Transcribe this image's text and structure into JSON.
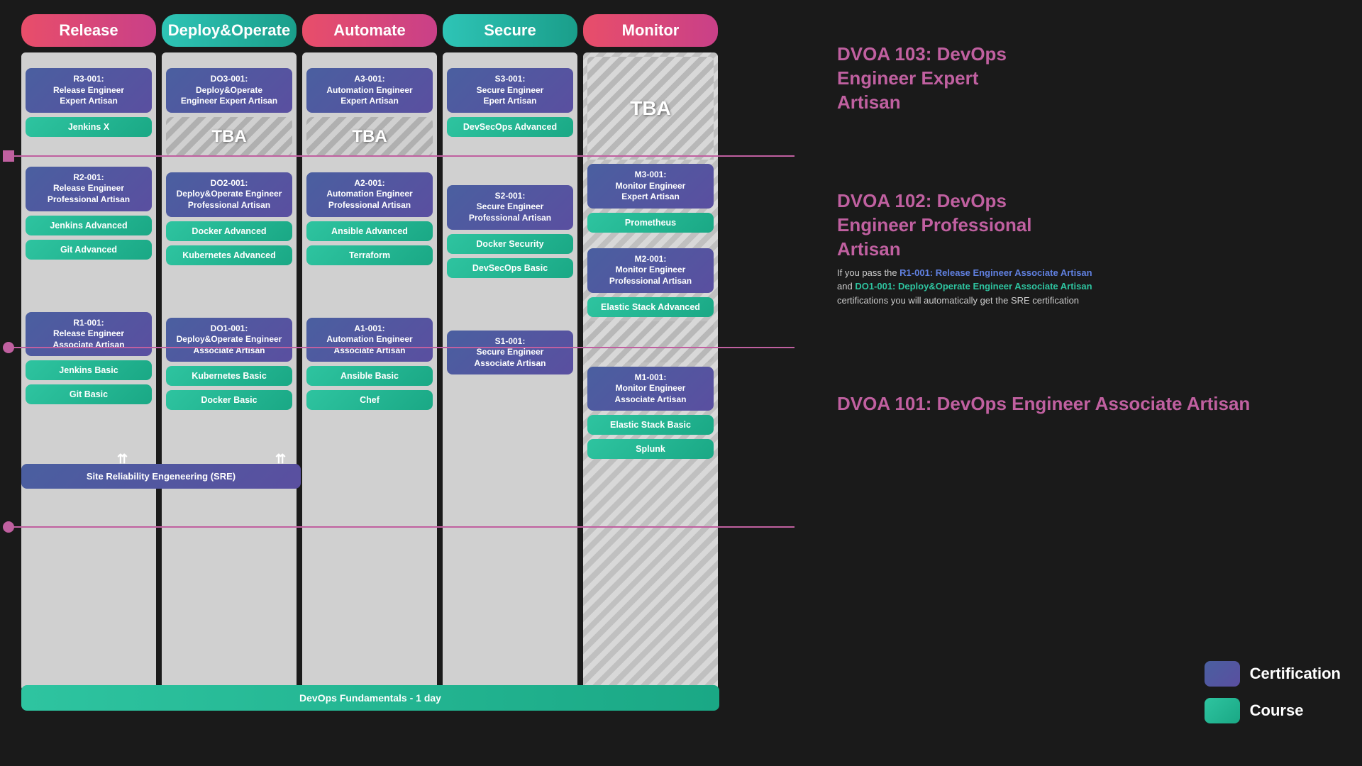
{
  "headers": {
    "release": "Release",
    "deploy": "Deploy&Operate",
    "automate": "Automate",
    "secure": "Secure",
    "monitor": "Monitor"
  },
  "columns": {
    "release": {
      "l3_cert": "R3-001:\nRelease Engineer\nExpert Artisan",
      "l3_course1": "Jenkins X",
      "l2_cert": "R2-001:\nRelease Engineer\nProfessional Artisan",
      "l2_course1": "Jenkins Advanced",
      "l2_course2": "Git Advanced",
      "sre": "Site Reliability Engeneering (SRE)",
      "l1_cert": "R1-001:\nRelease Engineer\nAssociate Artisan",
      "l1_course1": "Jenkins Basic",
      "l1_course2": "Git Basic"
    },
    "deploy": {
      "l3_cert": "DO3-001:\nDeploy&Operate\nEngineer Expert Artisan",
      "l3_tba": "TBA",
      "l2_cert": "DO2-001:\nDeploy&Operate Engineer\nProfessional Artisan",
      "l2_course1": "Docker Advanced",
      "l2_course2": "Kubernetes Advanced",
      "l1_cert": "DO1-001:\nDeploy&Operate Engineer\nAssociate Artisan",
      "l1_course1": "Kubernetes Basic",
      "l1_course2": "Docker Basic"
    },
    "automate": {
      "l3_cert": "A3-001:\nAutomation Engineer\nExpert Artisan",
      "l3_tba": "TBA",
      "l2_cert": "A2-001:\nAutomation Engineer\nProfessional Artisan",
      "l2_course1": "Ansible Advanced",
      "l2_course2": "Terraform",
      "l1_cert": "A1-001:\nAutomation Engineer\nAssociate Artisan",
      "l1_course1": "Ansible Basic",
      "l1_course2": "Chef"
    },
    "secure": {
      "l3_cert": "S3-001:\nSecure Engineer\nEpert Artisan",
      "l3_course1": "DevSecOps Advanced",
      "l2_cert": "S2-001:\nSecure Engineer\nProfessional Artisan",
      "l2_course1": "Docker Security",
      "l2_course2": "DevSecOps Basic",
      "l1_cert": "S1-001:\nSecure Engineer\nAssociate Artisan"
    },
    "monitor": {
      "l3_cert": "M3-001:\nMonitor Engineer\nExpert Artisan",
      "l3_course1": "Prometheus",
      "l2_cert": "M2-001:\nMonitor Engineer\nProfessional Artisan",
      "l2_course1": "Elastic Stack Advanced",
      "l1_cert": "M1-001:\nMonitor Engineer\nAssociate Artisan",
      "l1_course1": "Elastic Stack Basic",
      "l1_course2": "Splunk"
    }
  },
  "fundamentals": "DevOps Fundamentals - 1 day",
  "dvoa": {
    "l3": {
      "title": "DVOA 103: DevOps\nEngineer Expert\nArtisan"
    },
    "l2": {
      "title": "DVOA 102: DevOps\nEngineer Professional\nArtisan"
    },
    "l1": {
      "title": "DVOA 101: DevOps\nEngineer Associate Artisan"
    },
    "note": "If you pass the R1-001: Release Engineer Associate Artisan and DO1-001: Deploy&Operate Engineer Associate Artisan certifications you will automatically get the SRE certification"
  },
  "legend": {
    "cert_label": "Certification",
    "course_label": "Course"
  }
}
